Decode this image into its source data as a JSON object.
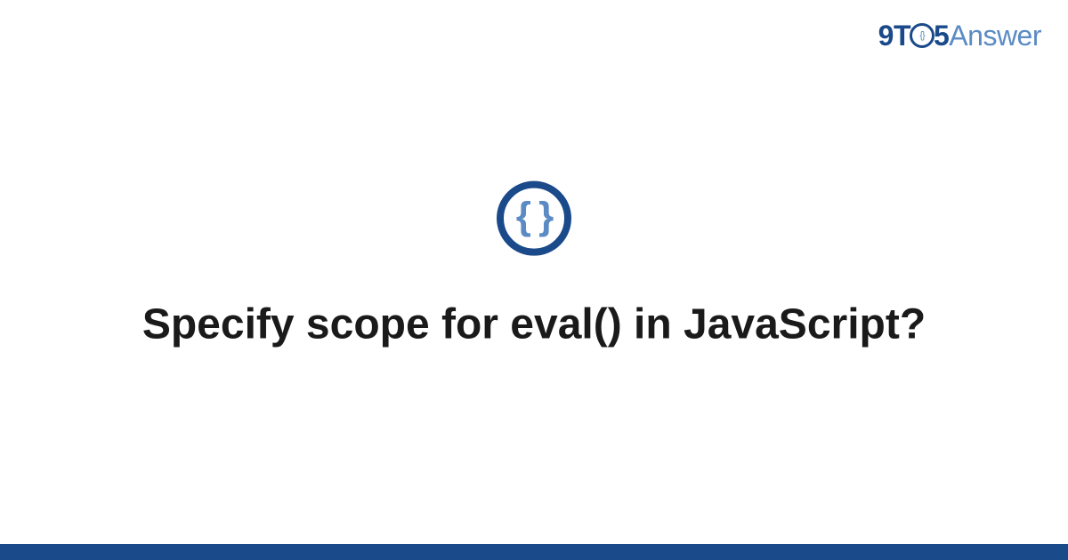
{
  "logo": {
    "part1": "9T",
    "circle_inner": "{}",
    "part2": "5",
    "part3": "Answer"
  },
  "icon": {
    "symbol": "{ }"
  },
  "title": "Specify scope for eval() in JavaScript?"
}
